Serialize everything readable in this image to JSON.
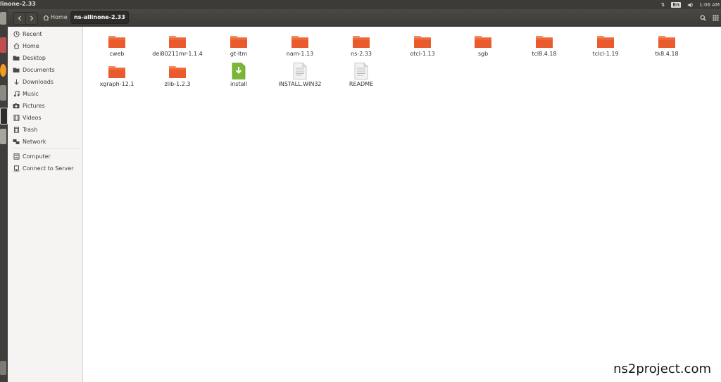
{
  "window": {
    "title": "linone-2.33"
  },
  "indicators": {
    "keyboard": "En",
    "volume": "◀)",
    "time": "1:06 AM",
    "network": "⇅"
  },
  "path": {
    "home_label": "Home",
    "current": "ns-allinone-2.33"
  },
  "sidebar": {
    "items": [
      {
        "label": "Recent",
        "icon": "clock-icon"
      },
      {
        "label": "Home",
        "icon": "home-icon"
      },
      {
        "label": "Desktop",
        "icon": "desktop-icon"
      },
      {
        "label": "Documents",
        "icon": "documents-icon"
      },
      {
        "label": "Downloads",
        "icon": "downloads-icon"
      },
      {
        "label": "Music",
        "icon": "music-icon"
      },
      {
        "label": "Pictures",
        "icon": "pictures-icon"
      },
      {
        "label": "Videos",
        "icon": "videos-icon"
      },
      {
        "label": "Trash",
        "icon": "trash-icon"
      },
      {
        "label": "Network",
        "icon": "network-icon"
      }
    ],
    "devices": [
      {
        "label": "Computer",
        "icon": "computer-icon"
      },
      {
        "label": "Connect to Server",
        "icon": "server-icon"
      }
    ]
  },
  "files": [
    {
      "name": "cweb",
      "type": "folder"
    },
    {
      "name": "dei80211mr-1.1.4",
      "type": "folder"
    },
    {
      "name": "gt-itm",
      "type": "folder"
    },
    {
      "name": "nam-1.13",
      "type": "folder"
    },
    {
      "name": "ns-2.33",
      "type": "folder"
    },
    {
      "name": "otcl-1.13",
      "type": "folder"
    },
    {
      "name": "sgb",
      "type": "folder"
    },
    {
      "name": "tcl8.4.18",
      "type": "folder"
    },
    {
      "name": "tclcl-1.19",
      "type": "folder"
    },
    {
      "name": "tk8.4.18",
      "type": "folder"
    },
    {
      "name": "xgraph-12.1",
      "type": "folder"
    },
    {
      "name": "zlib-1.2.3",
      "type": "folder"
    },
    {
      "name": "install",
      "type": "executable"
    },
    {
      "name": "INSTALL.WIN32",
      "type": "text"
    },
    {
      "name": "README",
      "type": "text"
    }
  ],
  "watermark": "ns2project.com",
  "colors": {
    "folder": "#e95a2c",
    "folder_tab": "#f08a5d",
    "executable": "#7ab735",
    "panel": "#3c3b37"
  }
}
